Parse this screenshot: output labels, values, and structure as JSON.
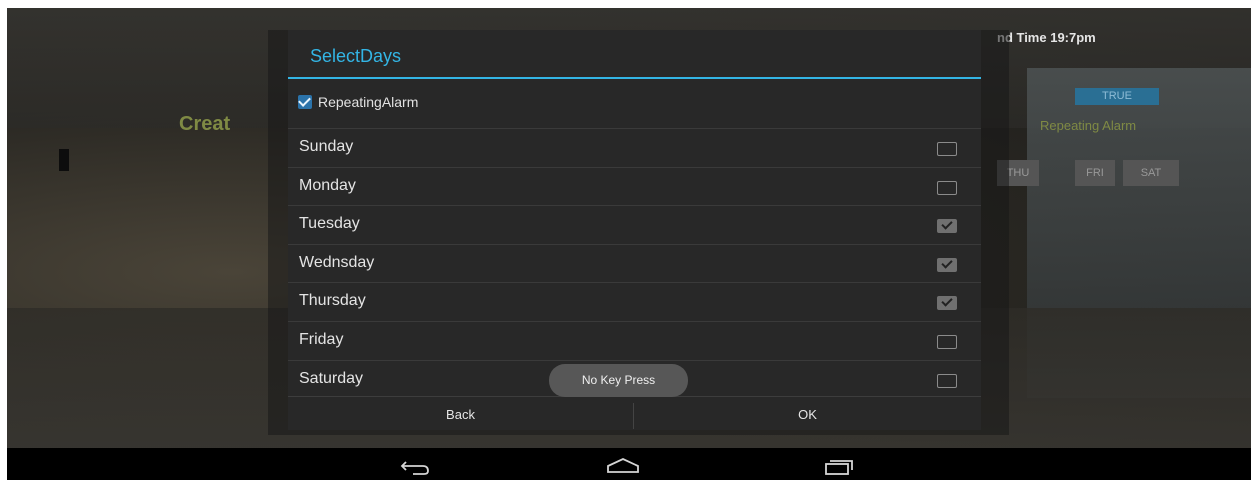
{
  "background": {
    "title_partial": "nd Time  19:7pm",
    "create_partial": "Creat",
    "true_badge": "TRUE",
    "repeating_alarm_label": "Repeating Alarm",
    "day_buttons": [
      "THU",
      "FRI",
      "SAT"
    ]
  },
  "dialog": {
    "title": "SelectDays",
    "repeating_alarm": {
      "label": "RepeatingAlarm",
      "checked": true
    },
    "days": [
      {
        "label": "Sunday",
        "checked": false
      },
      {
        "label": "Monday",
        "checked": false
      },
      {
        "label": "Tuesday",
        "checked": true
      },
      {
        "label": "Wednsday",
        "checked": true
      },
      {
        "label": "Thursday",
        "checked": true
      },
      {
        "label": "Friday",
        "checked": false
      },
      {
        "label": "Saturday",
        "checked": false
      }
    ],
    "back_label": "Back",
    "ok_label": "OK"
  },
  "toast": {
    "text": "No Key Press"
  },
  "navbar": {
    "back_icon": "back-arrow-icon",
    "home_icon": "home-icon",
    "recents_icon": "recent-apps-icon"
  },
  "colors": {
    "accent": "#33b5e5",
    "checkbox_blue": "#2b73aa",
    "dialog_bg": "#282828"
  }
}
